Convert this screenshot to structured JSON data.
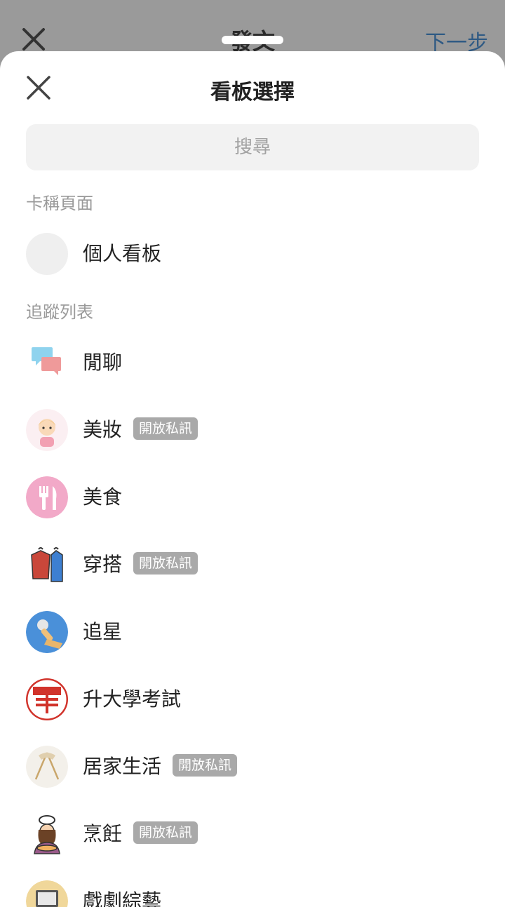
{
  "background_header": {
    "title": "發文",
    "next_label": "下一步"
  },
  "sheet": {
    "title": "看板選擇",
    "search": {
      "placeholder": "搜尋",
      "value": ""
    },
    "sections": {
      "profile_label": "卡稱頁面",
      "following_label": "追蹤列表"
    },
    "personal_board": {
      "label": "個人看板"
    },
    "boards": [
      {
        "name": "閒聊",
        "badge": "",
        "icon": "chat-bubbles-icon"
      },
      {
        "name": "美妝",
        "badge": "開放私訊",
        "icon": "makeup-girl-icon"
      },
      {
        "name": "美食",
        "badge": "",
        "icon": "fork-knife-icon"
      },
      {
        "name": "穿搭",
        "badge": "開放私訊",
        "icon": "clothes-rack-icon"
      },
      {
        "name": "追星",
        "badge": "",
        "icon": "microphone-icon"
      },
      {
        "name": "升大學考試",
        "badge": "",
        "icon": "exam-stamp-icon"
      },
      {
        "name": "居家生活",
        "badge": "開放私訊",
        "icon": "home-lamp-icon"
      },
      {
        "name": "烹飪",
        "badge": "開放私訊",
        "icon": "chef-icon"
      },
      {
        "name": "戲劇綜藝",
        "badge": "",
        "icon": "tv-icon"
      }
    ]
  },
  "colors": {
    "overlay": "#9a9a9a",
    "badge": "#a9a9a9",
    "link": "#2f5a84"
  }
}
